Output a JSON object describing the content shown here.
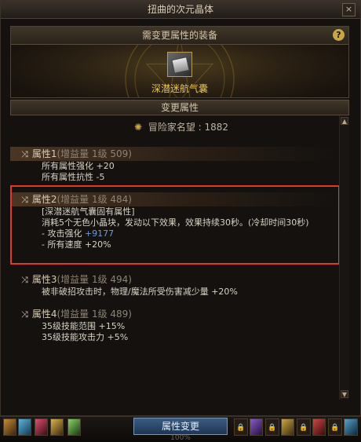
{
  "window": {
    "title": "扭曲的次元晶体",
    "close_label": "×"
  },
  "equip": {
    "header": "需变更属性的装备",
    "help_label": "?",
    "item_name": "深潜迷航气囊"
  },
  "change": {
    "header": "变更属性"
  },
  "fame": {
    "label": "冒险家名望 : 1882"
  },
  "attributes": [
    {
      "name": "属性1",
      "meta": "(增益量 1级 509)",
      "lines": [
        "所有属性强化 +20",
        "所有属性抗性 -5"
      ]
    },
    {
      "name": "属性2",
      "meta": "(增益量 1级 484)",
      "lines": [
        "[深潜迷航气囊固有属性]",
        "消耗5个无色小晶块，发动以下效果，效果持续30秒。(冷却时间30秒)"
      ],
      "line3_label": "- 攻击强化 ",
      "line3_value": "+9177",
      "line4": "- 所有速度 +20%"
    },
    {
      "name": "属性3",
      "meta": "(增益量 1级 494)",
      "lines": [
        "被非破招攻击时，物理/魔法所受伤害减少量 +20%"
      ]
    },
    {
      "name": "属性4",
      "meta": "(增益量 1级 489)",
      "lines": [
        "35级技能范围 +15%",
        "35级技能攻击力 +5%"
      ]
    }
  ],
  "bottom": {
    "button_label": "属性变更",
    "percent": "100%"
  },
  "colors": {
    "accent_gold": "#e8c65a",
    "highlight_red": "#e2372f",
    "value_blue": "#6f9bd8"
  }
}
